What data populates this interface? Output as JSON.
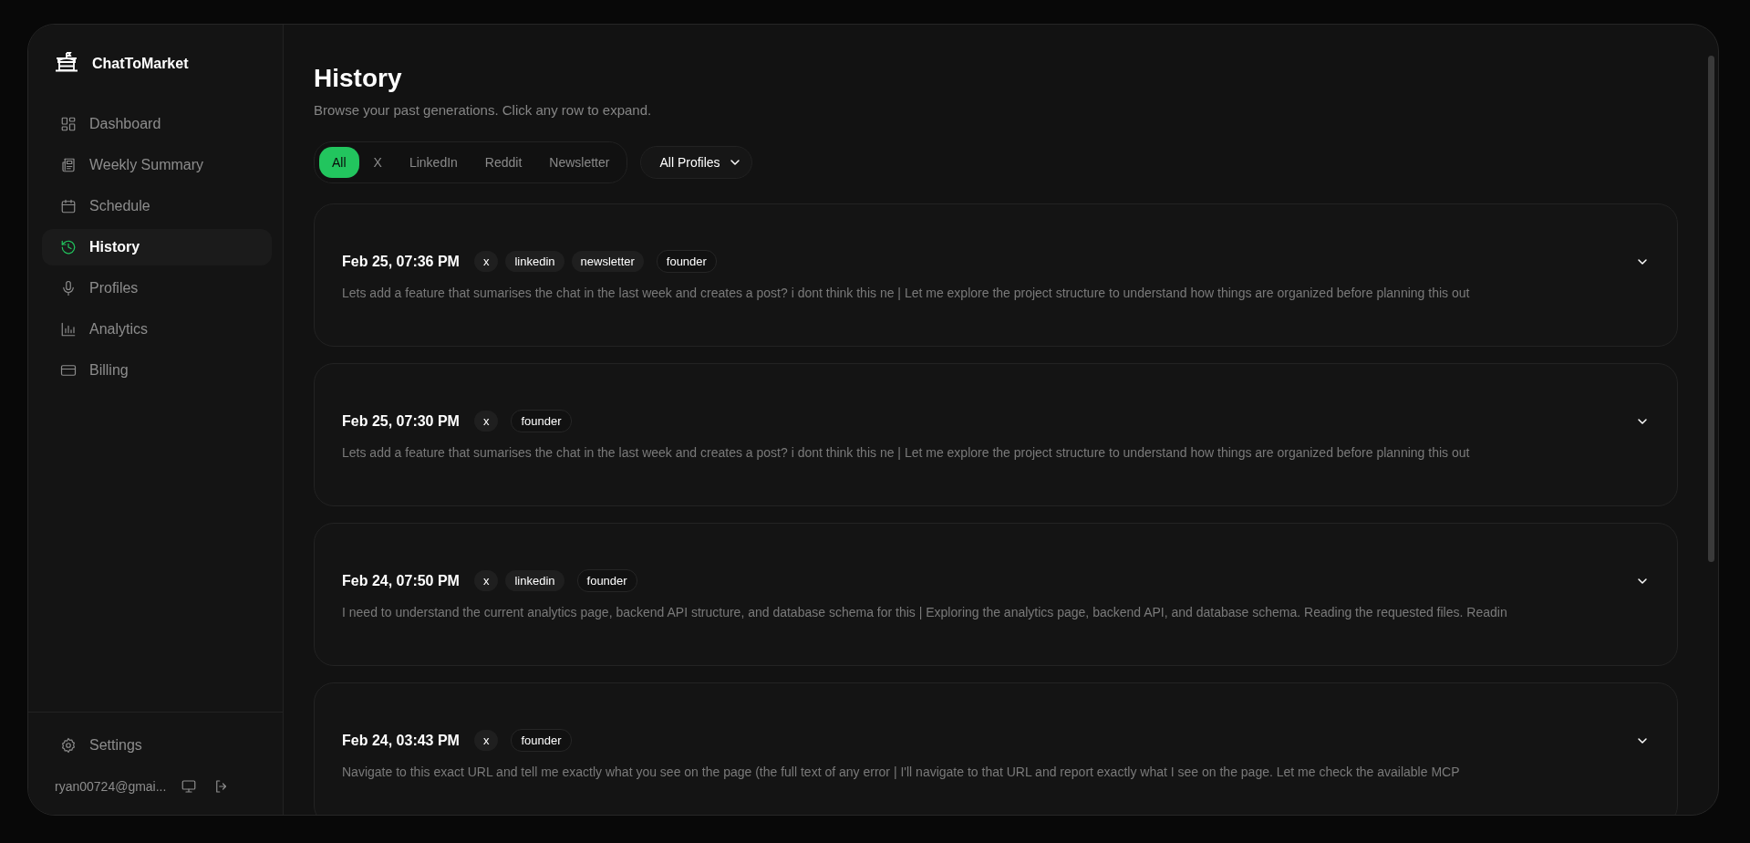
{
  "app": {
    "name": "ChatToMarket"
  },
  "sidebar": {
    "items": [
      {
        "label": "Dashboard",
        "selected": false
      },
      {
        "label": "Weekly Summary",
        "selected": false
      },
      {
        "label": "Schedule",
        "selected": false
      },
      {
        "label": "History",
        "selected": true
      },
      {
        "label": "Profiles",
        "selected": false
      },
      {
        "label": "Analytics",
        "selected": false
      },
      {
        "label": "Billing",
        "selected": false
      }
    ],
    "settings": {
      "label": "Settings"
    },
    "user": {
      "email": "ryan00724@gmai..."
    }
  },
  "page": {
    "title": "History",
    "subtitle": "Browse your past generations. Click any row to expand."
  },
  "filters": [
    {
      "label": "All",
      "selected": true
    },
    {
      "label": "X",
      "selected": false
    },
    {
      "label": "LinkedIn",
      "selected": false
    },
    {
      "label": "Reddit",
      "selected": false
    },
    {
      "label": "Newsletter",
      "selected": false
    }
  ],
  "profile_select": {
    "value": "All Profiles"
  },
  "entries": [
    {
      "date": "Feb 25, 07:36 PM",
      "tags": [
        {
          "label": "x",
          "kind": "platform"
        },
        {
          "label": "linkedin",
          "kind": "platform"
        },
        {
          "label": "newsletter",
          "kind": "platform"
        },
        {
          "label": "founder",
          "kind": "profile"
        }
      ],
      "preview": "Lets add a feature that sumarises the chat in the last week and creates a post? i dont think this ne | Let me explore the project structure to understand how things are organized before planning this out",
      "expanded": false
    },
    {
      "date": "Feb 25, 07:30 PM",
      "tags": [
        {
          "label": "x",
          "kind": "platform"
        },
        {
          "label": "founder",
          "kind": "profile"
        }
      ],
      "preview": "Lets add a feature that sumarises the chat in the last week and creates a post? i dont think this ne | Let me explore the project structure to understand how things are organized before planning this out",
      "expanded": false
    },
    {
      "date": "Feb 24, 07:50 PM",
      "tags": [
        {
          "label": "x",
          "kind": "platform"
        },
        {
          "label": "linkedin",
          "kind": "platform"
        },
        {
          "label": "founder",
          "kind": "profile"
        }
      ],
      "preview": "I need to understand the current analytics page, backend API structure, and database schema for this | Exploring the analytics page, backend API, and database schema. Reading the requested files. Readin",
      "expanded": false
    },
    {
      "date": "Feb 24, 03:43 PM",
      "tags": [
        {
          "label": "x",
          "kind": "platform"
        },
        {
          "label": "founder",
          "kind": "profile"
        }
      ],
      "preview": "Navigate to this exact URL and tell me exactly what you see on the page (the full text of any error | I'll navigate to that URL and report exactly what I see on the page. Let me check the available MCP",
      "expanded": false
    }
  ]
}
